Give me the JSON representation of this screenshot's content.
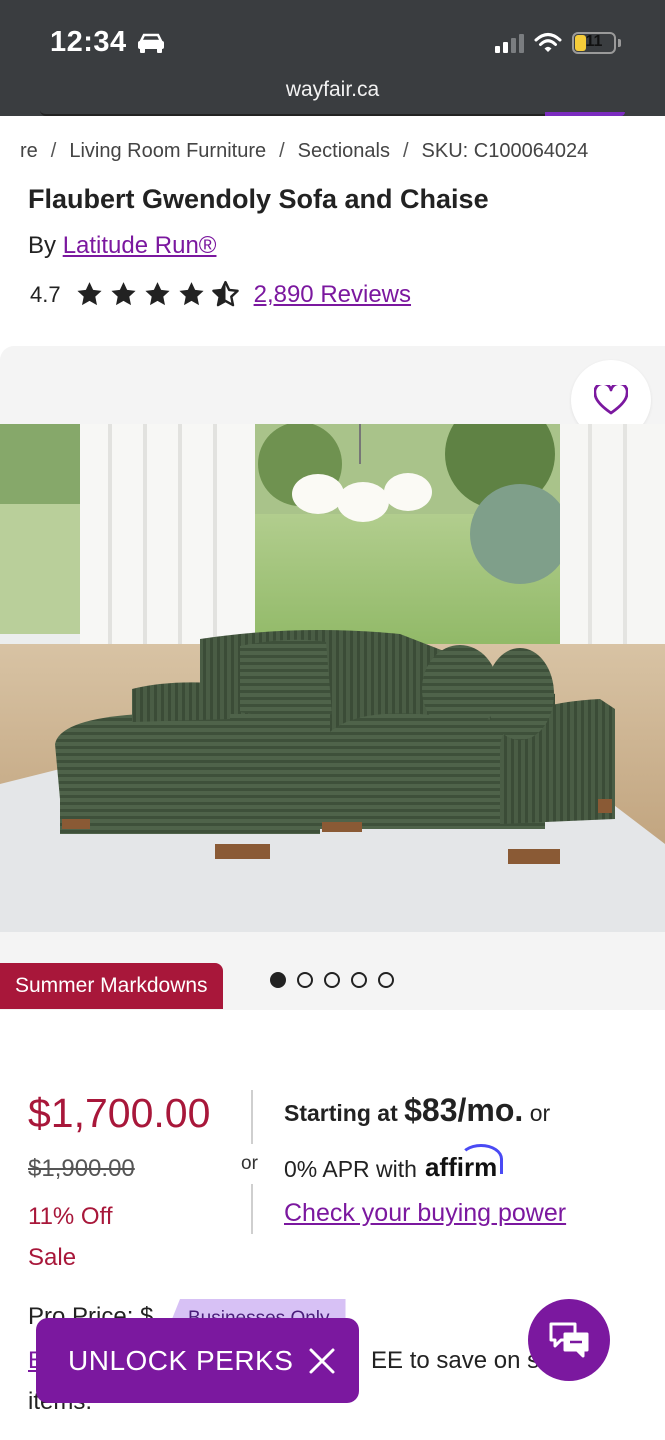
{
  "status_bar": {
    "time": "12:34",
    "battery": "11",
    "url": "wayfair.ca"
  },
  "breadcrumb": {
    "items": [
      "re",
      "Living Room Furniture",
      "Sectionals",
      "SKU: C100064024"
    ],
    "separator": "/"
  },
  "product": {
    "title": "Flaubert Gwendoly Sofa and Chaise",
    "by_label": "By",
    "brand": "Latitude Run®",
    "rating": "4.7",
    "rating_stars": 4.7,
    "reviews": "2,890 Reviews"
  },
  "gallery": {
    "badge": "Summer Markdowns",
    "dots_total": 5,
    "dot_active": 0
  },
  "pricing": {
    "price": "$1,700.00",
    "was_price": "$1,900.00",
    "discount": "11% Off",
    "sale_label": "Sale",
    "or_label": "or",
    "starting_label": "Starting at",
    "monthly": "$83/mo.",
    "starting_or": "or",
    "apr_text": "0% APR with",
    "affirm": "affirm",
    "buying_power": "Check your buying power"
  },
  "promo": {
    "pro_price": "Pro Price: $",
    "business_tag": "Businesses Only",
    "join_prefix": "E",
    "join_suffix": "EE to save on s",
    "items": "items."
  },
  "unlock": {
    "label": "UNLOCK PERKS"
  },
  "colors": {
    "brand_purple": "#7b189f",
    "sale_red": "#a8173a",
    "status_bar": "#3a3d40"
  }
}
